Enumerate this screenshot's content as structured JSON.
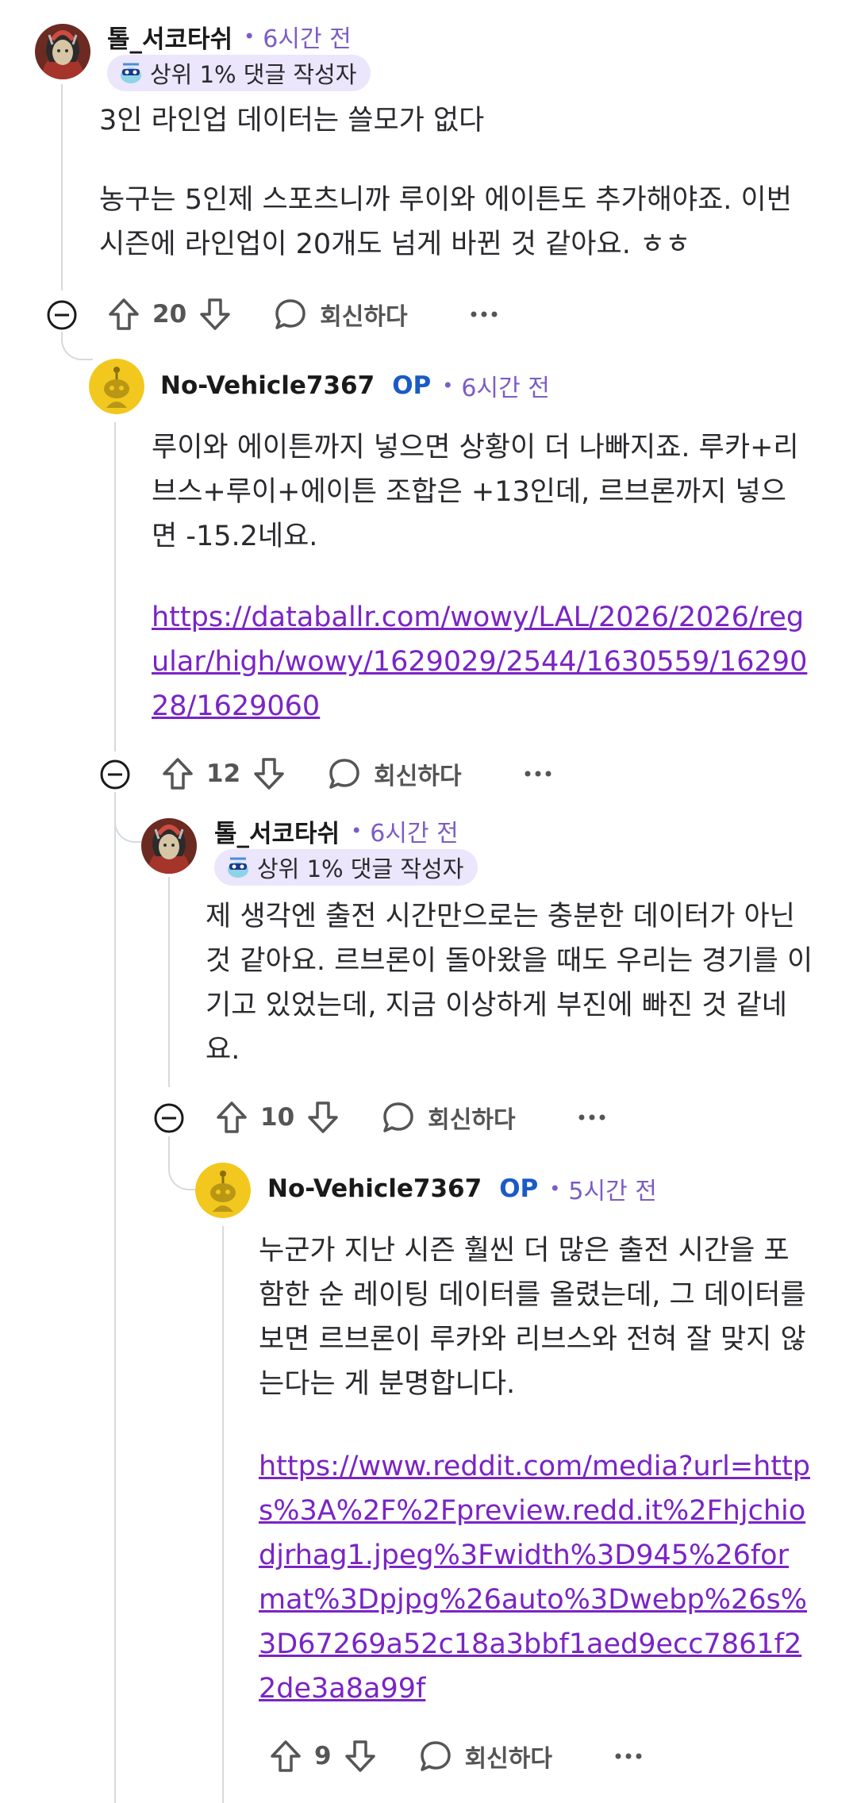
{
  "comments": [
    {
      "username": "톨_서코타쉬",
      "time": "6시간 전",
      "badge": "상위 1% 댓글 작성자",
      "paragraphs": [
        "3인 라인업 데이터는 쓸모가 없다",
        "농구는 5인제 스포츠니까 루이와 에이튼도 추가해야죠. 이번 시즌에 라인업이 20개도 넘게 바뀐 것 같아요. ㅎㅎ"
      ],
      "votes": "20",
      "reply": "회신하다"
    },
    {
      "username": "No-Vehicle7367",
      "op": "OP",
      "time": "6시간 전",
      "paragraphs": [
        "루이와 에이튼까지 넣으면 상황이 더 나빠지죠. 루카+리브스+루이+에이튼 조합은 +13인데, 르브론까지 넣으면 -15.2네요."
      ],
      "link": "https://databallr.com/wowy/LAL/2026/2026/regular/high/wowy/1629029/2544/1630559/1629028/1629060",
      "votes": "12",
      "reply": "회신하다"
    },
    {
      "username": "톨_서코타쉬",
      "time": "6시간 전",
      "badge": "상위 1% 댓글 작성자",
      "paragraphs": [
        "제 생각엔 출전 시간만으로는 충분한 데이터가 아닌 것 같아요. 르브론이 돌아왔을 때도 우리는 경기를 이기고 있었는데, 지금 이상하게 부진에 빠진 것 같네요."
      ],
      "votes": "10",
      "reply": "회신하다"
    },
    {
      "username": "No-Vehicle7367",
      "op": "OP",
      "time": "5시간 전",
      "paragraphs": [
        "누군가 지난 시즌 훨씬 더 많은 출전 시간을 포함한 순 레이팅 데이터를 올렸는데, 그 데이터를 보면 르브론이 루카와 리브스와 전혀 잘 맞지 않는다는 게 분명합니다."
      ],
      "link": "https://www.reddit.com/media?url=https%3A%2F%2Fpreview.redd.it%2Fhjchiodjrhag1.jpeg%3Fwidth%3D945%26format%3Dpjpg%26auto%3Dwebp%26s%3D67269a52c18a3bbf1aed9ecc7861f22de3a8a99f",
      "votes": "9",
      "reply": "회신하다"
    }
  ]
}
